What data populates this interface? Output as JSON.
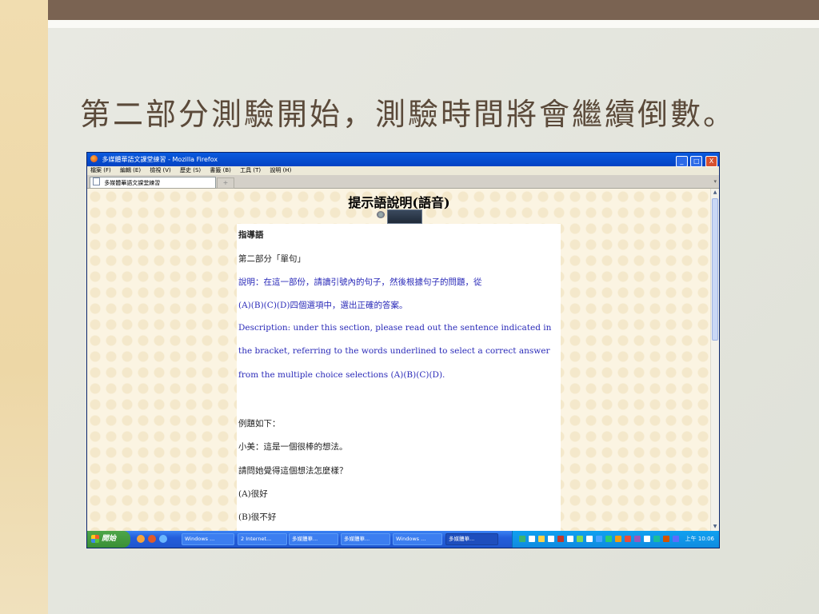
{
  "slide": {
    "title": "第二部分測驗開始，測驗時間將會繼續倒數。"
  },
  "window": {
    "title": "多媒體華語文課堂練習 - Mozilla Firefox",
    "controls": [
      "_",
      "□",
      "X"
    ],
    "menu": [
      "檔案 (F)",
      "編輯 (E)",
      "檢視 (V)",
      "歷史 (S)",
      "書籤 (B)",
      "工具 (T)",
      "說明 (H)"
    ],
    "tab_label": "多媒體華語文課堂練習",
    "new_tab": "+"
  },
  "page": {
    "heading": "提示語說明(語音)",
    "lines": [
      {
        "text": "指導語",
        "style": "bold"
      },
      {
        "text": "第二部分「單句」",
        "style": "normal"
      },
      {
        "text": "說明：在這一部份，請讀引號內的句子，然後根據句子的問題，從",
        "style": "blue"
      },
      {
        "text": "(A)(B)(C)(D)四個選項中，選出正確的答案。",
        "style": "blue"
      },
      {
        "text": "Description: under this section, please read out the sentence indicated in",
        "style": "blue"
      },
      {
        "text": "the bracket, referring to the words underlined to select a correct answer",
        "style": "blue"
      },
      {
        "text": "from the multiple choice selections (A)(B)(C)(D).",
        "style": "blue"
      },
      {
        "text": "例題如下：",
        "style": "normal"
      },
      {
        "text": "小美：這是一個很棒的想法。",
        "style": "normal"
      },
      {
        "text": "請問她覺得這個想法怎麼樣？",
        "style": "normal"
      },
      {
        "text": "(A)很好",
        "style": "normal"
      },
      {
        "text": "(B)很不好",
        "style": "normal"
      }
    ]
  },
  "taskbar": {
    "start": "開始",
    "buttons": [
      "Windows ...",
      "2 Internet...",
      "多媒體華...",
      "多媒體華...",
      "Windows ...",
      "多媒體華..."
    ],
    "active_index": 5,
    "clock": "上午 10:06"
  }
}
